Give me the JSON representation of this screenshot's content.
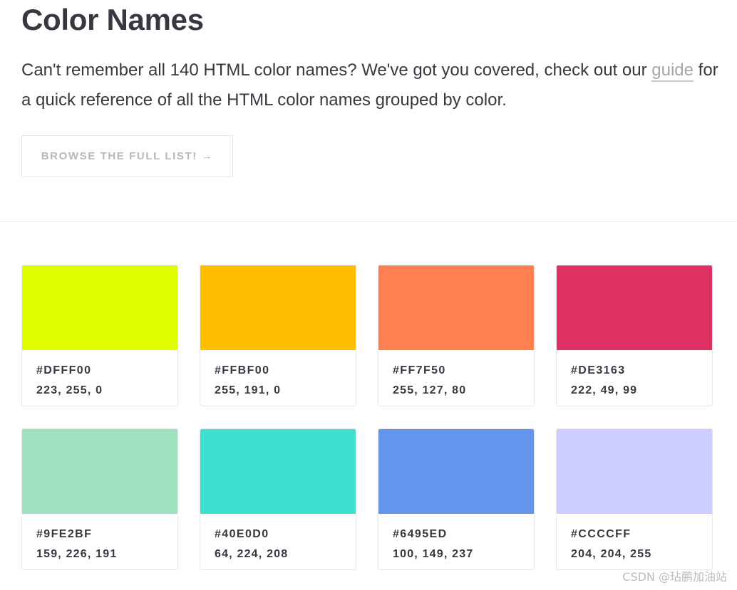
{
  "header": {
    "title": "Color Names",
    "desc_before": "Can't remember all 140 HTML color names? We've got you covered, check out our ",
    "desc_link": "guide",
    "desc_after": " for a quick reference of all the HTML color names grouped by color."
  },
  "browse_button": {
    "label": "BROWSE THE FULL LIST! →"
  },
  "colors": [
    {
      "hex": "#DFFF00",
      "rgb": "223, 255, 0"
    },
    {
      "hex": "#FFBF00",
      "rgb": "255, 191, 0"
    },
    {
      "hex": "#FF7F50",
      "rgb": "255, 127, 80"
    },
    {
      "hex": "#DE3163",
      "rgb": "222, 49, 99"
    },
    {
      "hex": "#9FE2BF",
      "rgb": "159, 226, 191"
    },
    {
      "hex": "#40E0D0",
      "rgb": "64, 224, 208"
    },
    {
      "hex": "#6495ED",
      "rgb": "100, 149, 237"
    },
    {
      "hex": "#CCCCFF",
      "rgb": "204, 204, 255"
    }
  ],
  "watermark": "CSDN @玷鹏加油站"
}
